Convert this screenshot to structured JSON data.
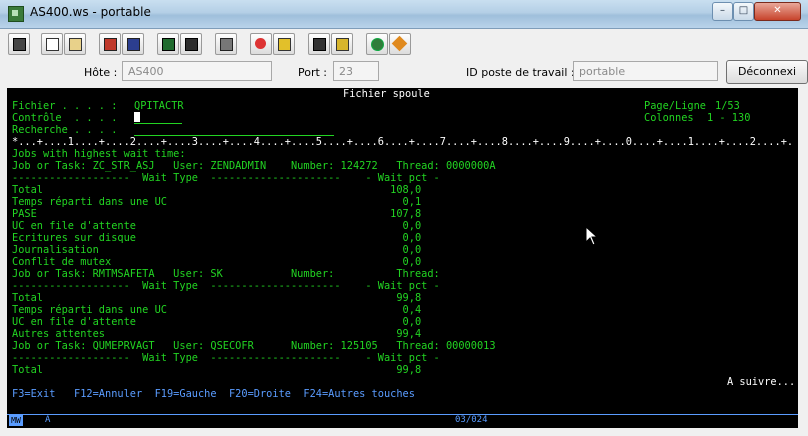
{
  "window": {
    "title": "AS400.ws - portable"
  },
  "toolbar": {
    "buttons": [
      "print-icon",
      "copy-icon",
      "paste-icon",
      "send-icon",
      "receive-icon",
      "display-icon",
      "macro-icon",
      "keyboard-icon",
      "record-icon",
      "play-icon",
      "stop-icon",
      "pause-icon",
      "globe-icon",
      "edit-icon"
    ]
  },
  "connection": {
    "host_label": "Hôte :",
    "host_value": "AS400",
    "port_label": "Port :",
    "port_value": "23",
    "station_label": "ID poste de travail :",
    "station_value": "portable",
    "disconnect_label": "Déconnexi"
  },
  "screen": {
    "header": "Fichier spoule",
    "fichier_label": "Fichier . . . . :",
    "fichier_value": "QPITACTR",
    "controle_label": "Contrôle  . . . .",
    "recherche_label": "Recherche . . . .",
    "page_label": "Page/Ligne",
    "page_value": "1/53",
    "colonnes_label": "Colonnes",
    "colonnes_value": "1 - 130",
    "ruler": "*...+....1....+....2....+....3....+....4....+....5....+....6....+....7....+....8....+....9....+....0....+....1....+....2....+....3",
    "lines": [
      "Jobs with highest wait time:",
      "Job or Task: ZC_STR_ASJ   User: ZENDADMIN    Number: 124272   Thread: 0000000A",
      "-------------------  Wait Type  ---------------------    - Wait pct -",
      "Total                                                        108,0",
      "Temps réparti dans une UC                                      0,1",
      "PASE                                                         107,8",
      "UC en file d'attente                                           0,0",
      "Ecritures sur disque                                           0,0",
      "Journalisation                                                 0,0",
      "Conflit de mutex                                               0,0",
      "Job or Task: RMTMSAFETA   User: SK           Number:          Thread:",
      "-------------------  Wait Type  ---------------------    - Wait pct -",
      "Total                                                         99,8",
      "Temps réparti dans une UC                                      0,4",
      "UC en file d'attente                                           0,0",
      "Autres attentes                                               99,4",
      "Job or Task: QUMEPRVAGT   User: QSECOFR      Number: 125105   Thread: 00000013",
      "-------------------  Wait Type  ---------------------    - Wait pct -",
      "Total                                                         99,8"
    ],
    "more": "A suivre...",
    "fkeys": "F3=Exit   F12=Annuler  F19=Gauche  F20=Droite  F24=Autres touches"
  },
  "oia": {
    "mode": "MW",
    "indicator": "A",
    "cursor_pos": "03/024"
  }
}
